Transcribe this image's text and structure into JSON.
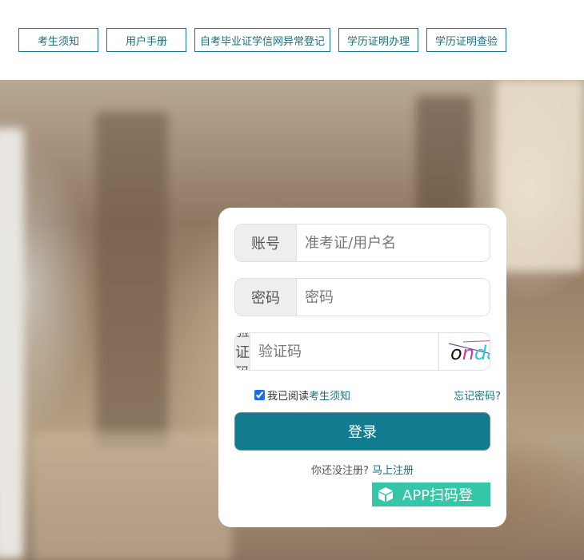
{
  "nav": {
    "items": [
      {
        "label": "考生须知"
      },
      {
        "label": "用户手册"
      },
      {
        "label": "自考毕业证学信网异常登记"
      },
      {
        "label": "学历证明办理"
      },
      {
        "label": "学历证明查验"
      }
    ]
  },
  "login": {
    "account_label": "账号",
    "account_placeholder": "准考证/用户名",
    "password_label": "密码",
    "password_placeholder": "密码",
    "captcha_label": "验证码",
    "captcha_placeholder": "验证码",
    "captcha_text": "onda",
    "agree_prefix": "我已阅读",
    "agree_link": "考生须知",
    "agree_checked": true,
    "forgot": "忘记密码?",
    "submit": "登录",
    "register_prompt": "你还没注册?",
    "register_link": "马上注册",
    "app_login": "APP扫码登"
  },
  "colors": {
    "accent": "#137b8e",
    "link": "#1a6f80",
    "app_button": "#34c6a6"
  }
}
